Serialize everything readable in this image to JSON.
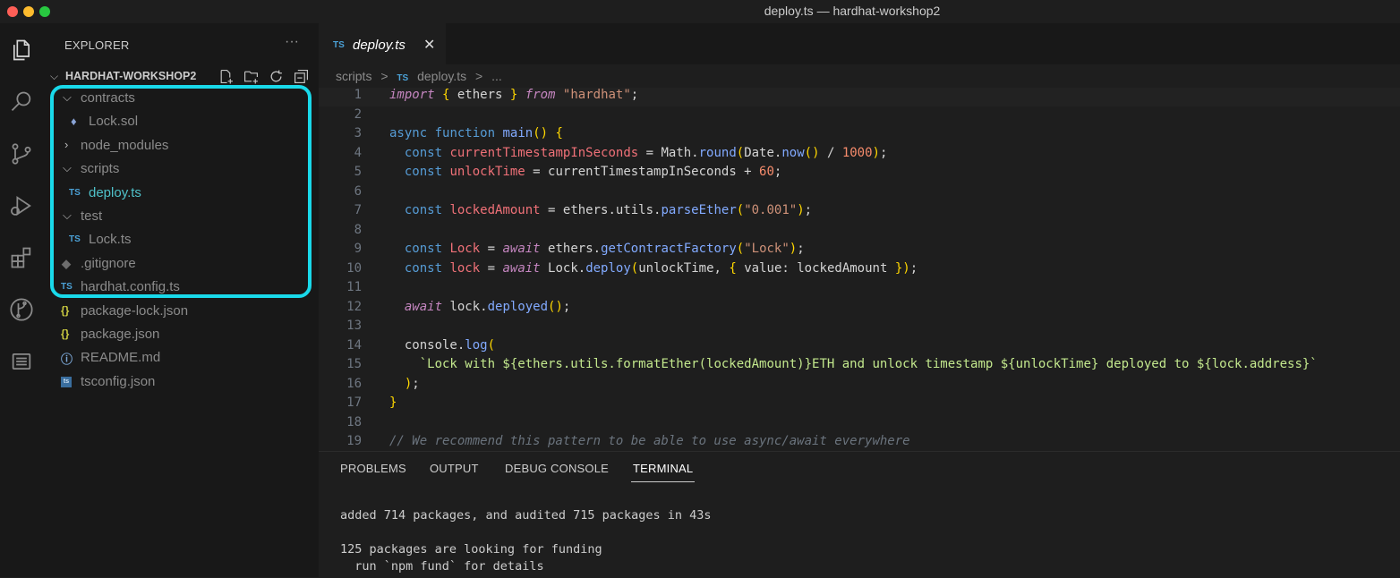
{
  "window": {
    "title": "deploy.ts — hardhat-workshop2"
  },
  "activity_bar": {
    "icons": [
      "files-icon",
      "search-icon",
      "source-control-icon",
      "run-debug-icon",
      "extensions-icon",
      "git-graph-icon",
      "output-icon"
    ]
  },
  "sidebar": {
    "title": "EXPLORER",
    "more": "···",
    "project": "HARDHAT-WORKSHOP2",
    "tree": [
      {
        "name": "contracts",
        "type": "folder",
        "open": true
      },
      {
        "name": "Lock.sol",
        "type": "file",
        "icon": "solidity-icon"
      },
      {
        "name": "node_modules",
        "type": "folder",
        "open": false
      },
      {
        "name": "scripts",
        "type": "folder",
        "open": true
      },
      {
        "name": "deploy.ts",
        "type": "file",
        "icon": "TS",
        "active": true
      },
      {
        "name": "test",
        "type": "folder",
        "open": true
      },
      {
        "name": "Lock.ts",
        "type": "file",
        "icon": "TS"
      },
      {
        "name": ".gitignore",
        "type": "file",
        "icon": "git-icon"
      },
      {
        "name": "hardhat.config.ts",
        "type": "file",
        "icon": "TS"
      },
      {
        "name": "package-lock.json",
        "type": "file",
        "icon": "{}"
      },
      {
        "name": "package.json",
        "type": "file",
        "icon": "{}"
      },
      {
        "name": "README.md",
        "type": "file",
        "icon": "info-icon"
      },
      {
        "name": "tsconfig.json",
        "type": "file",
        "icon": "tsconfig-icon"
      }
    ],
    "highlight_color": "#19d9ea"
  },
  "editor": {
    "tab": {
      "icon": "TS",
      "label": "deploy.ts",
      "close": "✕"
    },
    "breadcrumb": [
      "scripts",
      ">",
      "TS",
      "deploy.ts",
      ">",
      "..."
    ],
    "lines": [
      {
        "n": "1",
        "code": "import { ethers } from \"hardhat\";"
      },
      {
        "n": "2",
        "code": ""
      },
      {
        "n": "3",
        "code": "async function main() {"
      },
      {
        "n": "4",
        "code": "  const currentTimestampInSeconds = Math.round(Date.now() / 1000);"
      },
      {
        "n": "5",
        "code": "  const unlockTime = currentTimestampInSeconds + 60;"
      },
      {
        "n": "6",
        "code": ""
      },
      {
        "n": "7",
        "code": "  const lockedAmount = ethers.utils.parseEther(\"0.001\");"
      },
      {
        "n": "8",
        "code": ""
      },
      {
        "n": "9",
        "code": "  const Lock = await ethers.getContractFactory(\"Lock\");"
      },
      {
        "n": "10",
        "code": "  const lock = await Lock.deploy(unlockTime, { value: lockedAmount });"
      },
      {
        "n": "11",
        "code": ""
      },
      {
        "n": "12",
        "code": "  await lock.deployed();"
      },
      {
        "n": "13",
        "code": ""
      },
      {
        "n": "14",
        "code": "  console.log("
      },
      {
        "n": "15",
        "code": "    `Lock with ${ethers.utils.formatEther(lockedAmount)}ETH and unlock timestamp ${unlockTime} deployed to ${lock.address}`"
      },
      {
        "n": "16",
        "code": "  );"
      },
      {
        "n": "17",
        "code": "}"
      },
      {
        "n": "18",
        "code": ""
      },
      {
        "n": "19",
        "code": "// We recommend this pattern to be able to use async/await everywhere"
      }
    ]
  },
  "panel": {
    "tabs": [
      "PROBLEMS",
      "OUTPUT",
      "DEBUG CONSOLE",
      "TERMINAL"
    ],
    "active_tab": "TERMINAL",
    "terminal": [
      "added 714 packages, and audited 715 packages in 43s",
      "",
      "125 packages are looking for funding",
      "  run `npm fund` for details"
    ]
  }
}
